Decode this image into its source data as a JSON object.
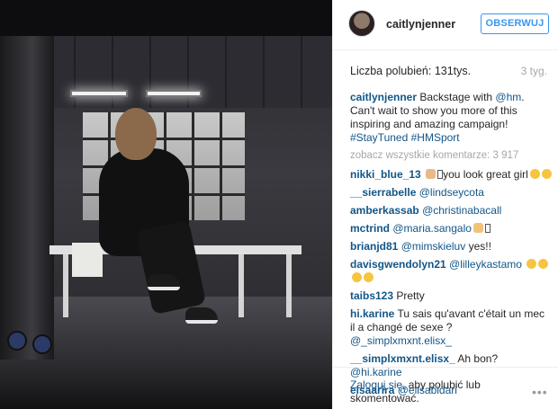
{
  "post": {
    "username": "caitlynjenner",
    "follow_label": "OBSERWUJ",
    "likes": "Liczba polubień: 131tys.",
    "age": "3 tyg.",
    "caption_user": "caitlynjenner",
    "caption_before": " Backstage with ",
    "caption_mention": "@hm",
    "caption_after": ". Can't wait to show you more of this inspiring and amazing campaign! ",
    "caption_tag1": "#StayTuned",
    "caption_tag2": "#HMSport",
    "view_all": "zobacz wszystkie komentarze: 3 917"
  },
  "comments": [
    {
      "user": "nikki_blue_13",
      "text": "you look great girl"
    },
    {
      "user": "__sierrabelle",
      "mention": "@lindseycota"
    },
    {
      "user": "amberkassab",
      "mention": "@christinabacall"
    },
    {
      "user": "mctrind",
      "mention": "@maria.sangalo"
    },
    {
      "user": "brianjd81",
      "mention": "@mimskieluv",
      "text": " yes!!"
    },
    {
      "user": "davisgwendolyn21",
      "mention": "@lilleykastamo"
    },
    {
      "user": "taibs123",
      "text": " Pretty"
    },
    {
      "user": "hi.karine",
      "text": " Tu sais qu'avant c'était un mec il a changé de sexe ?",
      "mention": "@_simplxmxnt.elisx_"
    },
    {
      "user": "__simplxmxnt.elisx_",
      "text": " Ah bon? ",
      "mention": "@hi.karine"
    },
    {
      "user": "elsaarira",
      "mention": "@elisabidari"
    }
  ],
  "footer": {
    "login_link": "Zaloguj się",
    "login_text": ", aby polubić lub skomentować.",
    "more_label": "•••"
  }
}
